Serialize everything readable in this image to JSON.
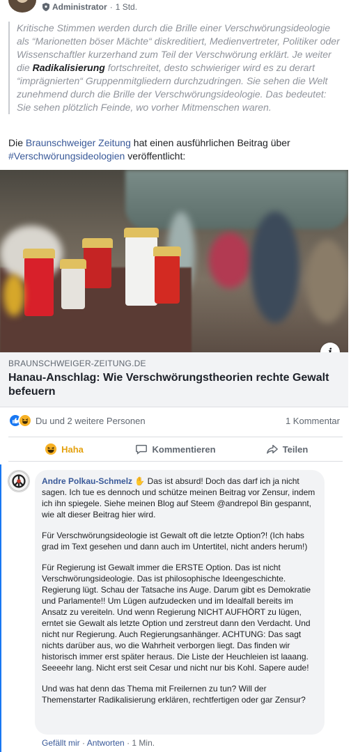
{
  "post": {
    "author": "Administrator",
    "time": "1 Std.",
    "quote_before": "Kritische Stimmen werden durch die Brille einer Verschwörungsideologie als “Marionetten böser Mächte“ diskreditiert, Medienvertreter, Politiker oder Wissenschaftler kurzerhand zum Teil der Verschwörung erklärt. Je weiter die ",
    "quote_bold": "Radikalisierung",
    "quote_after": " fortschreitet, desto schwieriger wird es zu derart “imprägnierten“ Gruppenmitgliedern durchzudringen. Sie sehen die Welt zunehmend durch die Brille der Verschwörungsideologie. Das bedeutet: Sie sehen plötzlich Feinde, wo vorher Mitmenschen waren.",
    "intro_1": "Die ",
    "intro_link_1": "Braunschweiger Zeitung",
    "intro_2": " hat einen ausführlichen Beitrag über ",
    "intro_link_2": "#Verschwörungsideologien",
    "intro_3": " veröffentlicht:"
  },
  "link_preview": {
    "domain": "BRAUNSCHWEIGER-ZEITUNG.DE",
    "title": "Hanau-Anschlag: Wie Verschwörungstheorien rechte Gewalt befeuern",
    "info_glyph": "i"
  },
  "reactions": {
    "summary": "Du und 2 weitere Personen",
    "comment_count": "1 Kommentar",
    "like_color": "#1877f2",
    "haha_color": "#f7b125"
  },
  "actions": {
    "haha": "Haha",
    "comment": "Kommentieren",
    "share": "Teilen"
  },
  "comment": {
    "author": "Andre Polkau-Schmelz",
    "hand_emoji": "✋",
    "p1": " Das ist absurd! Doch das darf ich ja nicht sagen. Ich tue es dennoch und schütze meinen Beitrag vor Zensur, indem ich ihn spiegele. Siehe meinen Blog auf Steem @andrepol Bin gespannt, wie alt dieser Beitrag hier wird.",
    "p2": "Für Verschwörungsideologie ist Gewalt oft die letzte Option?! (Ich habs grad im Text gesehen und dann auch im Untertitel, nicht anders herum!)",
    "p3": "Für Regierung ist Gewalt immer die ERSTE Option. Das ist nicht Verschwörungsideologie. Das ist philosophische Ideengeschichte. Regierung lügt. Schau der Tatsache ins Auge. Darum gibt es Demokratie und Parlamente!! Um Lügen aufzudecken und im Idealfall bereits im Ansatz zu vereiteln. Und wenn Regierung NICHT AUFHÖRT zu lügen, erntet sie Gewalt als letzte Option und zerstreut dann den Verdacht. Und nicht nur Regierung. Auch Regierungsanhänger. ACHTUNG: Das sagt nichts darüber aus, wo die Wahrheit verborgen liegt. Das finden wir historisch immer erst später heraus. Die Liste der Heuchleien ist laaang. Seeeehr lang. Nicht erst seit Cesar und nicht nur bis Kohl. Sapere aude!",
    "p4": "Und was hat denn das Thema mit Freilernen zu tun? Will der Themenstarter Radikalisierung erklären, rechtfertigen oder gar Zensur?",
    "like": "Gefällt mir",
    "sep1": " · ",
    "reply": "Antworten",
    "sep2": " · ",
    "time": "1 Min."
  }
}
